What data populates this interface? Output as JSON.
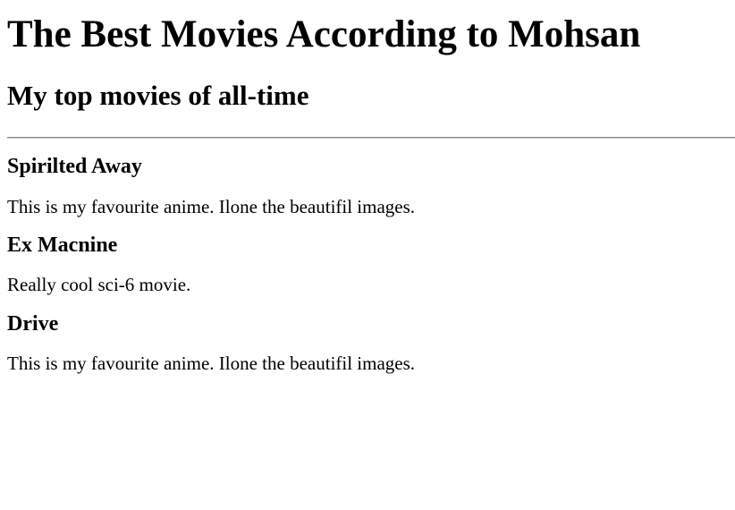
{
  "page": {
    "title": "The Best Movies According to Mohsan",
    "subtitle": "My top movies of all-time"
  },
  "movies": [
    {
      "title": "Spirilted Away",
      "description": "This is my favourite anime. Ilone the beautifil images."
    },
    {
      "title": "Ex Macnine",
      "description": "Really cool sci-6 movie."
    },
    {
      "title": "Drive",
      "description": "This is my favourite anime. Ilone the beautifil images."
    }
  ]
}
